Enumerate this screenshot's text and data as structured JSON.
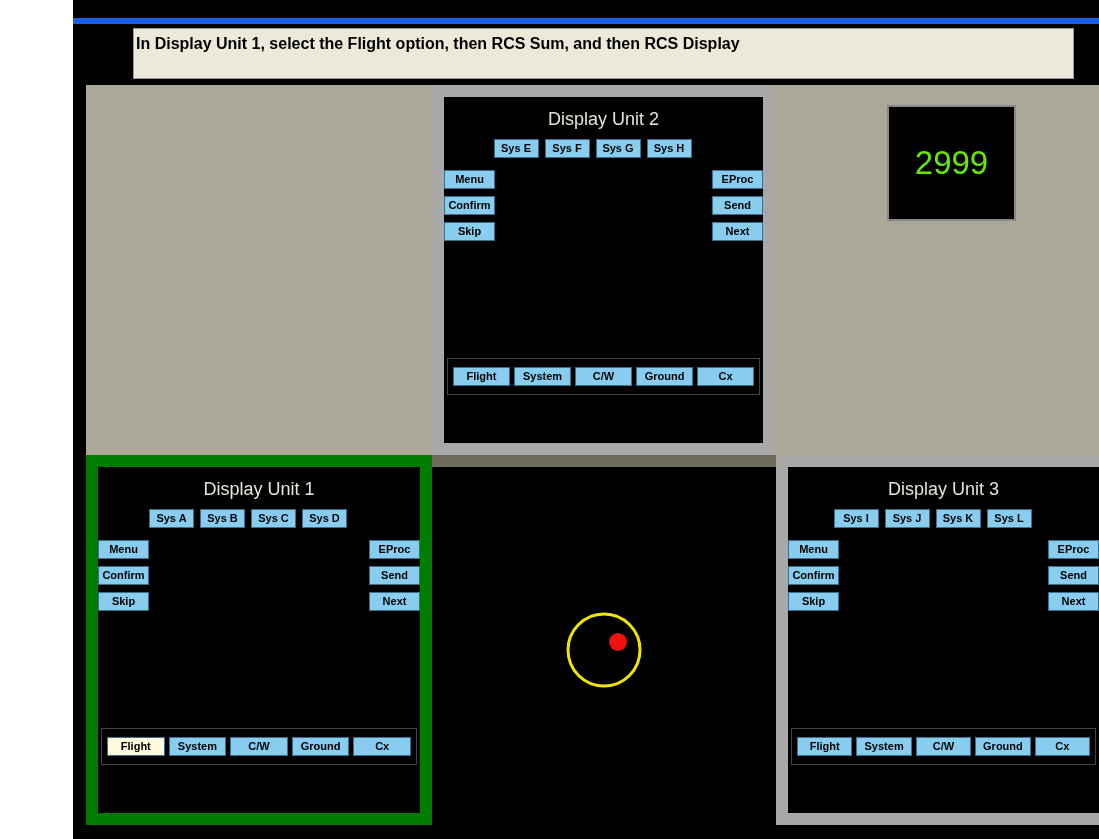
{
  "instruction": "In Display Unit 1, select the Flight option, then RCS Sum, and then RCS Display",
  "display_units": [
    {
      "title": "Display Unit 2",
      "highlighted": false,
      "systems": [
        "Sys E",
        "Sys F",
        "Sys G",
        "Sys H"
      ],
      "left_buttons": [
        "Menu",
        "Confirm",
        "Skip"
      ],
      "right_buttons": [
        "EProc",
        "Send",
        "Next"
      ],
      "tabs": [
        {
          "label": "Flight",
          "selected": false
        },
        {
          "label": "System",
          "selected": false
        },
        {
          "label": "C/W",
          "selected": false
        },
        {
          "label": "Ground",
          "selected": false
        },
        {
          "label": "Cx",
          "selected": false
        }
      ]
    },
    {
      "title": "Display Unit 1",
      "highlighted": true,
      "systems": [
        "Sys A",
        "Sys B",
        "Sys C",
        "Sys D"
      ],
      "left_buttons": [
        "Menu",
        "Confirm",
        "Skip"
      ],
      "right_buttons": [
        "EProc",
        "Send",
        "Next"
      ],
      "tabs": [
        {
          "label": "Flight",
          "selected": true
        },
        {
          "label": "System",
          "selected": false
        },
        {
          "label": "C/W",
          "selected": false
        },
        {
          "label": "Ground",
          "selected": false
        },
        {
          "label": "Cx",
          "selected": false
        }
      ]
    },
    {
      "title": "Display Unit 3",
      "highlighted": false,
      "systems": [
        "Sys I",
        "Sys J",
        "Sys K",
        "Sys L"
      ],
      "left_buttons": [
        "Menu",
        "Confirm",
        "Skip"
      ],
      "right_buttons": [
        "EProc",
        "Send",
        "Next"
      ],
      "tabs": [
        {
          "label": "Flight",
          "selected": false
        },
        {
          "label": "System",
          "selected": false
        },
        {
          "label": "C/W",
          "selected": false
        },
        {
          "label": "Ground",
          "selected": false
        },
        {
          "label": "Cx",
          "selected": false
        }
      ]
    }
  ],
  "counter": "2999"
}
